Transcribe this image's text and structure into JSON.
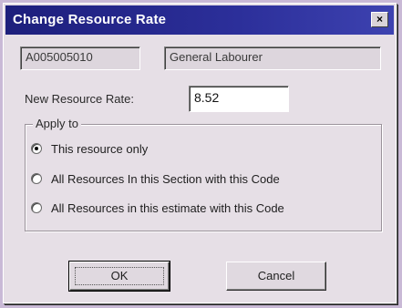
{
  "window": {
    "title": "Change Resource Rate",
    "close_glyph": "×"
  },
  "resource": {
    "code": "A005005010",
    "name": "General Labourer"
  },
  "rate": {
    "label": "New Resource Rate:",
    "value": "8.52"
  },
  "apply_to": {
    "legend": "Apply to",
    "options": [
      {
        "label": "This resource only",
        "checked": true
      },
      {
        "label": "All Resources In this Section with this Code",
        "checked": false
      },
      {
        "label": "All Resources in this estimate with this Code",
        "checked": false
      }
    ]
  },
  "buttons": {
    "ok_label": "OK",
    "cancel_label": "Cancel"
  },
  "colors": {
    "titlebar": "#1d1f7c",
    "dialog_bg": "#e6dfe6"
  }
}
